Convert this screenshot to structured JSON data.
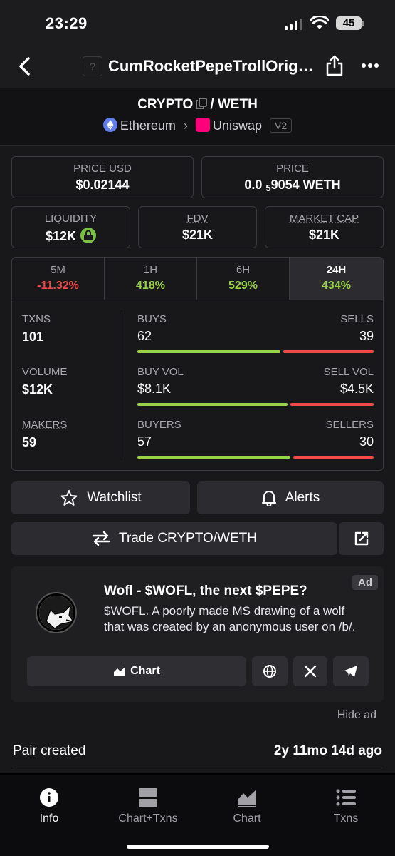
{
  "status": {
    "time": "23:29",
    "battery": "45"
  },
  "nav": {
    "title": "CumRocketPepeTrollOrigi…",
    "logo_placeholder": "?"
  },
  "pair": {
    "base": "CRYPTO",
    "slash": "/",
    "quote": "WETH",
    "chain": "Ethereum",
    "dex": "Uniswap",
    "version": "V2"
  },
  "prices": {
    "usd_label": "PRICE USD",
    "usd_value": "$0.02144",
    "price_label": "PRICE",
    "price_prefix": "0.0",
    "price_sub": "5",
    "price_suffix": "9054 WETH"
  },
  "metrics": [
    {
      "label": "LIQUIDITY",
      "value": "$12K"
    },
    {
      "label": "FDV",
      "value": "$21K"
    },
    {
      "label": "MARKET CAP",
      "value": "$21K"
    }
  ],
  "timeframes": [
    {
      "label": "5M",
      "value": "-11.32%"
    },
    {
      "label": "1H",
      "value": "418%"
    },
    {
      "label": "6H",
      "value": "529%"
    },
    {
      "label": "24H",
      "value": "434%"
    }
  ],
  "stats": {
    "txns_label": "TXNS",
    "txns": "101",
    "volume_label": "VOLUME",
    "volume": "$12K",
    "makers_label": "MAKERS",
    "makers": "59",
    "buys_label": "BUYS",
    "buys": "62",
    "sells_label": "SELLS",
    "sells": "39",
    "buyvol_label": "BUY VOL",
    "buyvol": "$8.1K",
    "sellvol_label": "SELL VOL",
    "sellvol": "$4.5K",
    "buyers_label": "BUYERS",
    "buyers": "57",
    "sellers_label": "SELLERS",
    "sellers": "30"
  },
  "actions": {
    "watchlist": "Watchlist",
    "alerts": "Alerts",
    "trade": "Trade CRYPTO/WETH"
  },
  "ad": {
    "tag": "Ad",
    "title": "Wofl - $WOFL, the next $PEPE?",
    "description": "$WOFL. A poorly made MS drawing of a wolf that was created by an anonymous user on /b/.",
    "chart_label": "Chart",
    "hide": "Hide ad"
  },
  "created": {
    "label": "Pair created",
    "value": "2y 11mo 14d ago"
  },
  "tabbar": [
    "Info",
    "Chart+Txns",
    "Chart",
    "Txns"
  ],
  "colors": {
    "green": "#98d14a",
    "red": "#f04a4a",
    "background": "#18181b"
  }
}
